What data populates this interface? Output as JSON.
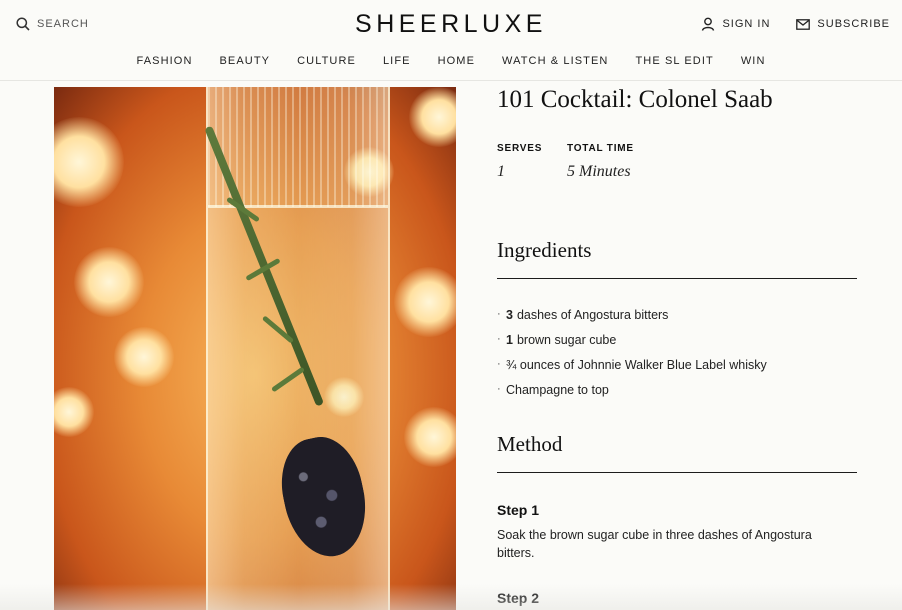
{
  "header": {
    "search_label": "SEARCH",
    "logo": "SHEERLUXE",
    "sign_in": "SIGN IN",
    "subscribe": "SUBSCRIBE",
    "icons": {
      "search": "search-icon",
      "sign_in": "user-icon",
      "subscribe": "envelope-icon"
    }
  },
  "nav": [
    "FASHION",
    "BEAUTY",
    "CULTURE",
    "LIFE",
    "HOME",
    "WATCH & LISTEN",
    "THE SL EDIT",
    "WIN"
  ],
  "recipe": {
    "title": "101 Cocktail: Colonel Saab",
    "serves_label": "SERVES",
    "serves_value": "1",
    "time_label": "TOTAL TIME",
    "time_value": "5 Minutes",
    "ingredients_title": "Ingredients",
    "ingredients": [
      {
        "qty": "3",
        "text": "dashes of Angostura bitters"
      },
      {
        "qty": "1",
        "text": "brown sugar cube"
      },
      {
        "qty": "",
        "text": "¾ ounces of Johnnie Walker Blue Label whisky"
      },
      {
        "qty": "",
        "text": "Champagne to top"
      }
    ],
    "method_title": "Method",
    "steps": [
      {
        "title": "Step 1",
        "text": "Soak the brown sugar cube in three dashes of Angostura bitters."
      },
      {
        "title": "Step 2",
        "text": ""
      }
    ]
  },
  "colors": {
    "background": "#fbfbf8",
    "text": "#1c1c1c",
    "image_warm": "#e88a36"
  }
}
